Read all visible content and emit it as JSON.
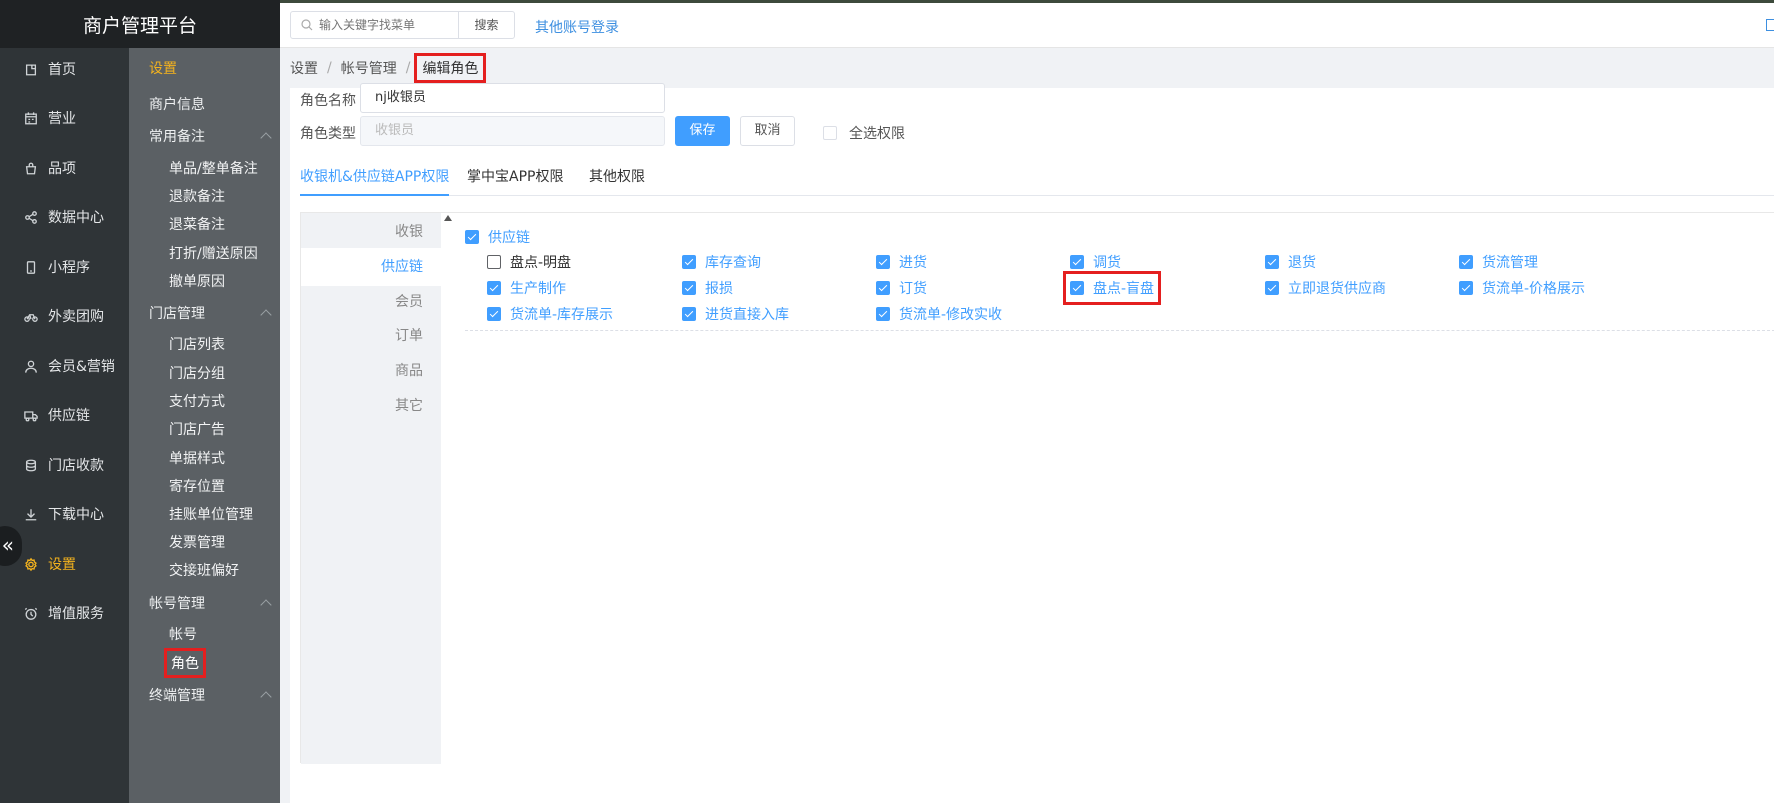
{
  "brand": "商户管理平台",
  "main_nav": [
    {
      "label": "首页",
      "icon": "home-icon"
    },
    {
      "label": "营业",
      "icon": "calendar-icon"
    },
    {
      "label": "品项",
      "icon": "bag-icon"
    },
    {
      "label": "数据中心",
      "icon": "share-icon"
    },
    {
      "label": "小程序",
      "icon": "mobile-icon"
    },
    {
      "label": "外卖团购",
      "icon": "bike-icon"
    },
    {
      "label": "会员&营销",
      "icon": "user-icon"
    },
    {
      "label": "供应链",
      "icon": "truck-icon"
    },
    {
      "label": "门店收款",
      "icon": "coins-icon"
    },
    {
      "label": "下载中心",
      "icon": "download-icon"
    },
    {
      "label": "设置",
      "icon": "gear-icon"
    },
    {
      "label": "增值服务",
      "icon": "clock-icon"
    }
  ],
  "collapse_glyph": "«",
  "submenu": {
    "title": "设置",
    "shop_info": "商户信息",
    "groups": {
      "notes": "常用备注",
      "store": "门店管理",
      "account": "帐号管理",
      "terminal": "终端管理"
    },
    "notes_items": [
      "单品/整单备注",
      "退款备注",
      "退菜备注",
      "打折/赠送原因",
      "撤单原因"
    ],
    "store_items": [
      "门店列表",
      "门店分组",
      "支付方式",
      "门店广告",
      "单据样式",
      "寄存位置",
      "挂账单位管理",
      "发票管理",
      "交接班偏好"
    ],
    "account_items": [
      "帐号",
      "角色"
    ]
  },
  "topbar": {
    "search_placeholder": "输入关键字找菜单",
    "search_button": "搜索",
    "other_login": "其他账号登录"
  },
  "breadcrumb": [
    "设置",
    "帐号管理",
    "编辑角色"
  ],
  "breadcrumb_sep": "/",
  "form": {
    "name_label": "角色名称",
    "name_value": "nj收银员",
    "type_label": "角色类型",
    "type_value": "收银员",
    "save": "保存",
    "cancel": "取消",
    "select_all": "全选权限"
  },
  "tabs": [
    "收银机&供应链APP权限",
    "掌中宝APP权限",
    "其他权限"
  ],
  "categories": [
    "收银",
    "供应链",
    "会员",
    "订单",
    "商品",
    "其它"
  ],
  "permissions": {
    "group_label": "供应链",
    "group_checked": true,
    "items": [
      {
        "label": "盘点-明盘",
        "checked": false
      },
      {
        "label": "库存查询",
        "checked": true
      },
      {
        "label": "进货",
        "checked": true
      },
      {
        "label": "调货",
        "checked": true
      },
      {
        "label": "退货",
        "checked": true
      },
      {
        "label": "货流管理",
        "checked": true
      },
      {
        "label": "生产制作",
        "checked": true
      },
      {
        "label": "报损",
        "checked": true
      },
      {
        "label": "订货",
        "checked": true
      },
      {
        "label": "盘点-盲盘",
        "checked": true
      },
      {
        "label": "立即退货供应商",
        "checked": true
      },
      {
        "label": "货流单-价格展示",
        "checked": true
      },
      {
        "label": "货流单-库存展示",
        "checked": true
      },
      {
        "label": "进货直接入库",
        "checked": true
      },
      {
        "label": "货流单-修改实收",
        "checked": true
      }
    ]
  },
  "colors": {
    "accent": "#409eff",
    "nav_active": "#f3b21e",
    "highlight_box": "#e41f1f"
  }
}
